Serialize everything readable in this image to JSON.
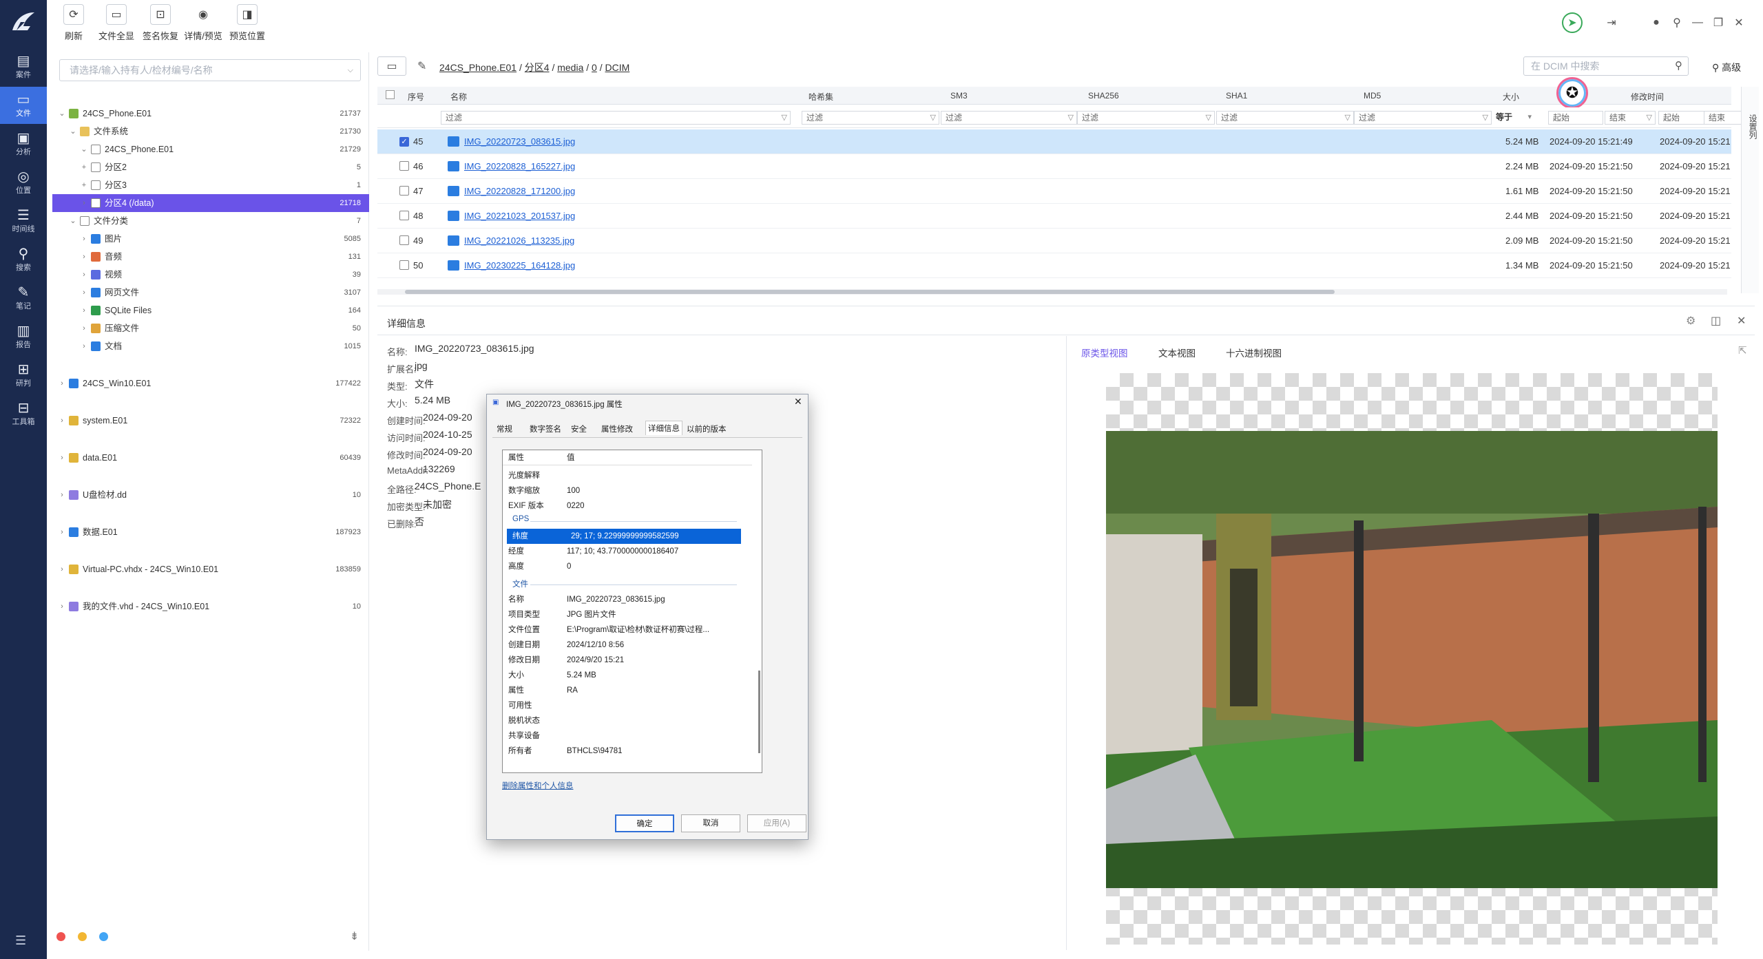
{
  "toolbar": {
    "refresh": "刷新",
    "show_all_files": "文件全显",
    "signature_recovery": "签名恢复",
    "detail_preview": "详情/预览",
    "preview_position": "预览位置"
  },
  "nav": {
    "items": [
      {
        "label": "案件",
        "icon": "case-icon"
      },
      {
        "label": "文件",
        "icon": "file-icon",
        "active": true
      },
      {
        "label": "分析",
        "icon": "analysis-icon"
      },
      {
        "label": "位置",
        "icon": "location-icon"
      },
      {
        "label": "时间线",
        "icon": "timeline-icon"
      },
      {
        "label": "搜索",
        "icon": "search-icon"
      },
      {
        "label": "笔记",
        "icon": "note-icon"
      },
      {
        "label": "报告",
        "icon": "report-icon"
      },
      {
        "label": "研判",
        "icon": "judge-icon"
      },
      {
        "label": "工具箱",
        "icon": "toolbox-icon"
      }
    ]
  },
  "tree": {
    "placeholder": "请选择/输入持有人/检材编号/名称",
    "rows": [
      {
        "label": "24CS_Phone.E01",
        "count": "21737"
      },
      {
        "label": "文件系统",
        "count": "21730"
      },
      {
        "label": "24CS_Phone.E01",
        "count": "21729"
      },
      {
        "label": "分区2",
        "count": "5"
      },
      {
        "label": "分区3",
        "count": "1"
      },
      {
        "label": "分区4  (/data)",
        "count": "21718"
      },
      {
        "label": "文件分类",
        "count": "7"
      },
      {
        "label": "图片",
        "count": "5085"
      },
      {
        "label": "音频",
        "count": "131"
      },
      {
        "label": "视频",
        "count": "39"
      },
      {
        "label": "网页文件",
        "count": "3107"
      },
      {
        "label": "SQLite Files",
        "count": "164"
      },
      {
        "label": "压缩文件",
        "count": "50"
      },
      {
        "label": "文档",
        "count": "1015"
      },
      {
        "label": "24CS_Win10.E01",
        "count": "177422"
      },
      {
        "label": "system.E01",
        "count": "72322"
      },
      {
        "label": "data.E01",
        "count": "60439"
      },
      {
        "label": "U盘检材.dd",
        "count": "10"
      },
      {
        "label": "数据.E01",
        "count": "187923"
      },
      {
        "label": "Virtual-PC.vhdx - 24CS_Win10.E01",
        "count": "183859"
      },
      {
        "label": "我的文件.vhd - 24CS_Win10.E01",
        "count": "10"
      }
    ]
  },
  "breadcrumb": {
    "root": "24CS_Phone.E01",
    "sep": "/",
    "p1": "分区4",
    "p2": "media",
    "p3": "0",
    "p4": "DCIM"
  },
  "search": {
    "placeholder": "在 DCIM 中搜索",
    "advanced": "高级"
  },
  "table": {
    "headers": {
      "seq": "序号",
      "name": "名称",
      "hashset": "哈希集",
      "sm3": "SM3",
      "sha256": "SHA256",
      "sha1": "SHA1",
      "md5": "MD5",
      "size": "大小",
      "mtime": "修改时间"
    },
    "filter": "过滤",
    "eq": "等于",
    "start": "起始",
    "end": "结束",
    "rows": [
      {
        "seq": "45",
        "name": "IMG_20220723_083615.jpg",
        "size": "5.24 MB",
        "t1": "2024-09-20 15:21:49",
        "t2": "2024-09-20 15:21",
        "checked": true
      },
      {
        "seq": "46",
        "name": "IMG_20220828_165227.jpg",
        "size": "2.24 MB",
        "t1": "2024-09-20 15:21:50",
        "t2": "2024-09-20 15:21"
      },
      {
        "seq": "47",
        "name": "IMG_20220828_171200.jpg",
        "size": "1.61 MB",
        "t1": "2024-09-20 15:21:50",
        "t2": "2024-09-20 15:21"
      },
      {
        "seq": "48",
        "name": "IMG_20221023_201537.jpg",
        "size": "2.44 MB",
        "t1": "2024-09-20 15:21:50",
        "t2": "2024-09-20 15:21"
      },
      {
        "seq": "49",
        "name": "IMG_20221026_113235.jpg",
        "size": "2.09 MB",
        "t1": "2024-09-20 15:21:50",
        "t2": "2024-09-20 15:21"
      },
      {
        "seq": "50",
        "name": "IMG_20230225_164128.jpg",
        "size": "1.34 MB",
        "t1": "2024-09-20 15:21:50",
        "t2": "2024-09-20 15:21"
      }
    ],
    "side_label": "设置列"
  },
  "details": {
    "title": "详细信息",
    "fields": [
      {
        "k": "名称:",
        "v": "IMG_20220723_083615.jpg"
      },
      {
        "k": "扩展名:",
        "v": "jpg"
      },
      {
        "k": "类型:",
        "v": "文件"
      },
      {
        "k": "大小:",
        "v": "5.24 MB"
      },
      {
        "k": "创建时间:",
        "v": "2024-09-20"
      },
      {
        "k": "访问时间:",
        "v": "2024-10-25"
      },
      {
        "k": "修改时间:",
        "v": "2024-09-20"
      },
      {
        "k": "MetaAddr:",
        "v": "132269"
      },
      {
        "k": "全路径:",
        "v": "24CS_Phone.E"
      },
      {
        "k": "加密类型:",
        "v": "未加密"
      },
      {
        "k": "已删除:",
        "v": "否"
      }
    ]
  },
  "preview": {
    "tab1": "原类型视图",
    "tab2": "文本视图",
    "tab3": "十六进制视图"
  },
  "dialog": {
    "title": "IMG_20220723_083615.jpg 属性",
    "tabs": [
      "常规",
      "数字签名",
      "安全",
      "属性修改",
      "详细信息",
      "以前的版本"
    ],
    "col_prop": "属性",
    "col_val": "值",
    "rows_top": [
      {
        "k": "光度解释",
        "v": ""
      },
      {
        "k": "数字缩放",
        "v": "100"
      },
      {
        "k": "EXIF 版本",
        "v": "0220"
      }
    ],
    "gps_group": "GPS",
    "gps_rows": [
      {
        "k": "纬度",
        "v": "29; 17; 9.22999999999582599"
      },
      {
        "k": "经度",
        "v": "117; 10; 43.7700000000186407"
      },
      {
        "k": "高度",
        "v": "0"
      }
    ],
    "file_group": "文件",
    "file_rows": [
      {
        "k": "名称",
        "v": "IMG_20220723_083615.jpg"
      },
      {
        "k": "项目类型",
        "v": "JPG 图片文件"
      },
      {
        "k": "文件位置",
        "v": "E:\\Program\\取证\\检材\\数证杯初赛\\过程..."
      },
      {
        "k": "创建日期",
        "v": "2024/12/10 8:56"
      },
      {
        "k": "修改日期",
        "v": "2024/9/20 15:21"
      },
      {
        "k": "大小",
        "v": "5.24 MB"
      },
      {
        "k": "属性",
        "v": "RA"
      },
      {
        "k": "可用性",
        "v": ""
      },
      {
        "k": "脱机状态",
        "v": ""
      },
      {
        "k": "共享设备",
        "v": ""
      },
      {
        "k": "所有者",
        "v": "BTHCLS\\94781"
      }
    ],
    "remove_link": "删除属性和个人信息",
    "ok": "确定",
    "cancel": "取消",
    "apply": "应用(A)"
  }
}
